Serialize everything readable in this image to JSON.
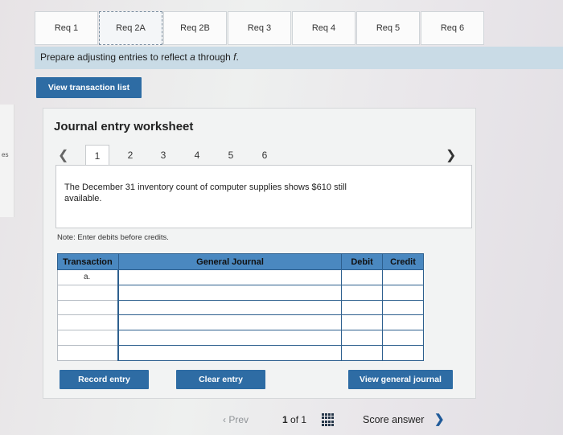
{
  "tabs": [
    {
      "label": "Req 1"
    },
    {
      "label": "Req 2A"
    },
    {
      "label": "Req 2B"
    },
    {
      "label": "Req 3"
    },
    {
      "label": "Req 4"
    },
    {
      "label": "Req 5"
    },
    {
      "label": "Req 6"
    }
  ],
  "active_tab": "Req 2A",
  "left_stub_text": "es",
  "instruction": {
    "prefix": "Prepare adjusting entries to reflect ",
    "italic": "a",
    "middle": " through ",
    "italic2": "f",
    "suffix": "."
  },
  "buttons": {
    "view_transaction_list": "View transaction list",
    "record_entry": "Record entry",
    "clear_entry": "Clear entry",
    "view_general_journal": "View general journal"
  },
  "worksheet": {
    "title": "Journal entry worksheet",
    "pager": {
      "prev_icon": "chevron-left-icon",
      "next_icon": "chevron-right-icon",
      "pages": [
        "1",
        "2",
        "3",
        "4",
        "5",
        "6"
      ],
      "current": "1"
    },
    "description": "The December 31 inventory count of computer supplies shows $610 still available.",
    "note": "Note: Enter debits before credits."
  },
  "journal": {
    "headers": {
      "transaction": "Transaction",
      "general_journal": "General Journal",
      "debit": "Debit",
      "credit": "Credit"
    },
    "rows": [
      {
        "transaction": "a.",
        "account": "",
        "debit": "",
        "credit": ""
      },
      {
        "transaction": "",
        "account": "",
        "debit": "",
        "credit": ""
      },
      {
        "transaction": "",
        "account": "",
        "debit": "",
        "credit": ""
      },
      {
        "transaction": "",
        "account": "",
        "debit": "",
        "credit": ""
      },
      {
        "transaction": "",
        "account": "",
        "debit": "",
        "credit": ""
      },
      {
        "transaction": "",
        "account": "",
        "debit": "",
        "credit": ""
      }
    ]
  },
  "footer": {
    "prev": "Prev",
    "page_current": "1",
    "page_of": "of",
    "page_total": "1",
    "score_answer": "Score answer",
    "grid_icon": "grid-icon",
    "next_icon": "chevron-right-icon"
  },
  "colors": {
    "button_blue": "#2e6ca4",
    "table_header": "#4a88c0",
    "instruction_bar": "#c9dbe6"
  }
}
